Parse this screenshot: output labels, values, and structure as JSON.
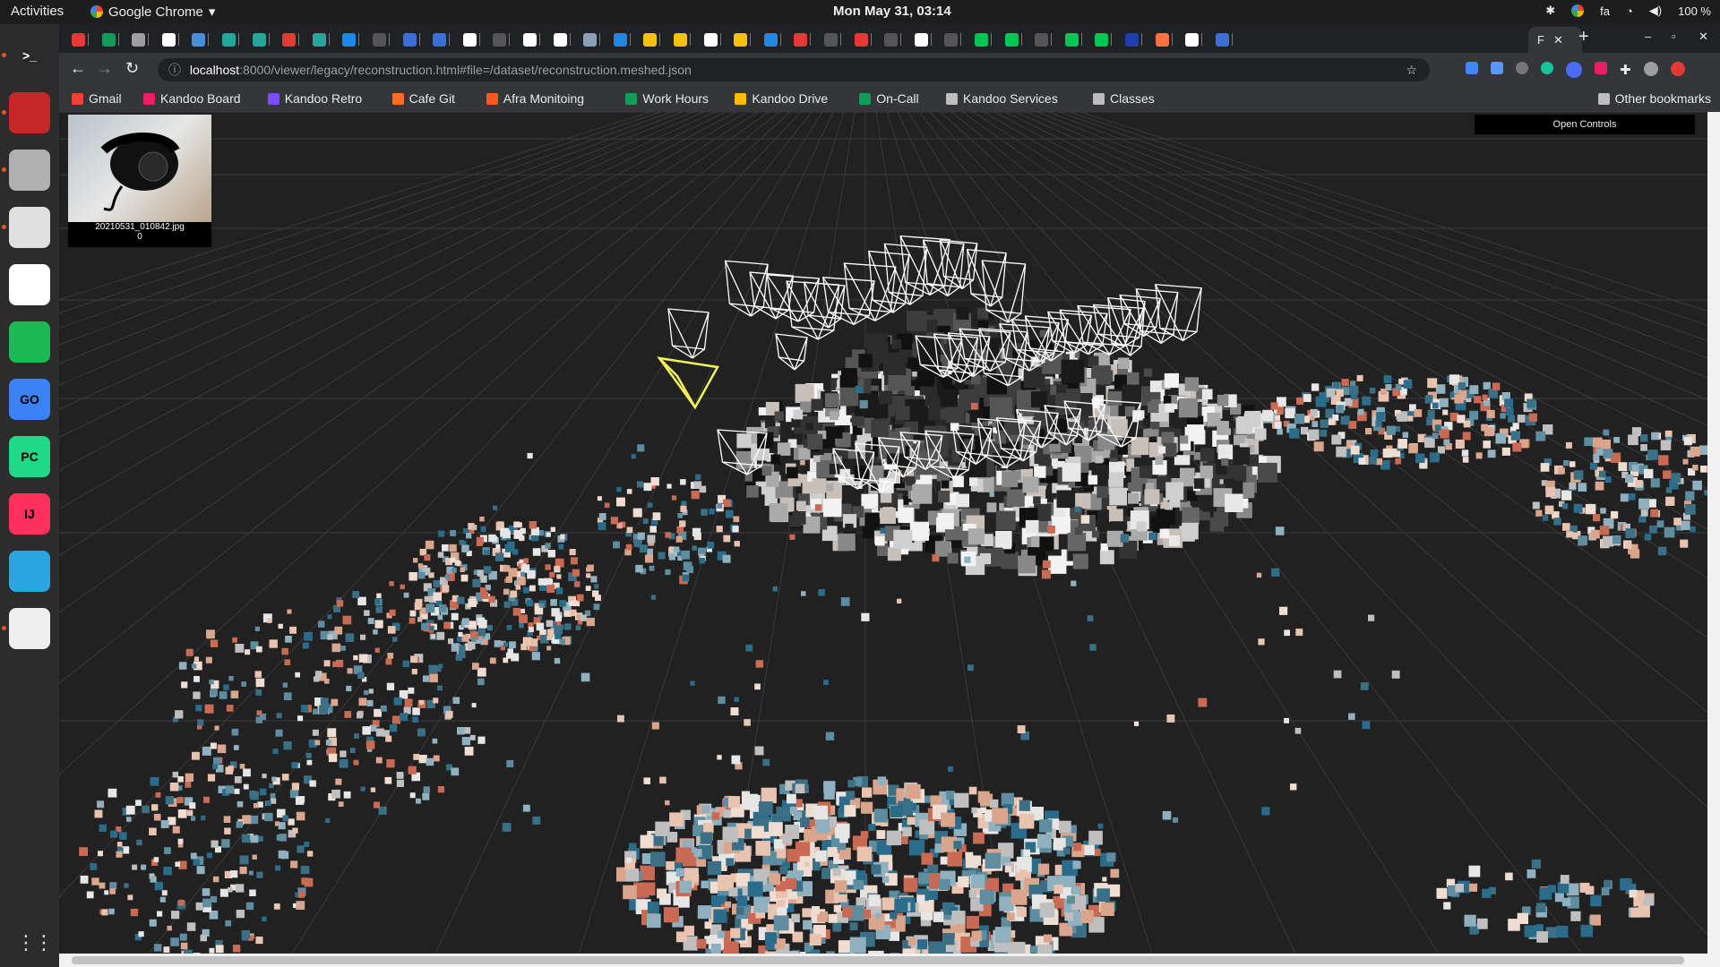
{
  "topbar": {
    "activities": "Activities",
    "app_name": "Google Chrome",
    "clock": "Mon May 31, 03:14",
    "input_lang": "fa",
    "battery": "100 %"
  },
  "dock": {
    "items": [
      {
        "name": "terminal",
        "label": ">_",
        "color": "#2b2b2b",
        "running": true
      },
      {
        "name": "slides-app",
        "label": "",
        "color": "#c62828",
        "running": true
      },
      {
        "name": "file-manager",
        "label": "",
        "color": "#b0b0b0",
        "running": true
      },
      {
        "name": "chrome",
        "label": "",
        "color": "#e0e0e0",
        "running": true
      },
      {
        "name": "slack",
        "label": "",
        "color": "#ffffff",
        "running": false
      },
      {
        "name": "spotify",
        "label": "",
        "color": "#1db954",
        "running": false
      },
      {
        "name": "goland",
        "label": "GO",
        "color": "#3b82f6",
        "running": false
      },
      {
        "name": "pycharm",
        "label": "PC",
        "color": "#21d789",
        "running": false
      },
      {
        "name": "intellij",
        "label": "IJ",
        "color": "#fe315d",
        "running": false
      },
      {
        "name": "telegram",
        "label": "",
        "color": "#2aa5e0",
        "running": false
      },
      {
        "name": "document-viewer",
        "label": "",
        "color": "#eeeeee",
        "running": true
      }
    ]
  },
  "tabs": {
    "favicon_colors": [
      "#e53935",
      "#0f9d58",
      "#9e9e9e",
      "#ffffff",
      "#4a90d9",
      "#26a69a",
      "#26a69a",
      "#e53935",
      "#26a69a",
      "#1e88e5",
      "#555555",
      "#3b6fd8",
      "#3b6fd8",
      "#ffffff",
      "#555555",
      "#ffffff",
      "#ffffff",
      "#8d9fb5",
      "#1e88e5",
      "#f4c20d",
      "#f4c20d",
      "#ffffff",
      "#f4c20d",
      "#1e88e5",
      "#e53935",
      "#555555",
      "#e53935",
      "#555555",
      "#ffffff",
      "#555555",
      "#00c853",
      "#00c853",
      "#555555",
      "#00c853",
      "#00c853",
      "#1e40af",
      "#ff7043",
      "#ffffff",
      "#3b6fd8"
    ],
    "active_tab_title": "F",
    "new_tab": "+"
  },
  "address": {
    "host": "localhost",
    "path": ":8000/viewer/legacy/reconstruction.html#file=/dataset/reconstruction.meshed.json"
  },
  "bookmarks": [
    {
      "label": "Gmail",
      "color": "#ea4335"
    },
    {
      "label": "Kandoo Board",
      "color": "#e91e63"
    },
    {
      "label": "Kandoo Retro",
      "color": "#7c4dff"
    },
    {
      "label": "Cafe Git",
      "color": "#fc6d26"
    },
    {
      "label": "Afra Monitoing",
      "color": "#ff5722"
    },
    {
      "label": "Work Hours",
      "color": "#0f9d58"
    },
    {
      "label": "Kandoo Drive",
      "color": "#fbbc05"
    },
    {
      "label": "On-Call",
      "color": "#0f9d58"
    },
    {
      "label": "Kandoo Services",
      "color": "#bdbdbd"
    },
    {
      "label": "Classes",
      "color": "#bdbdbd"
    }
  ],
  "other_bookmarks": "Other bookmarks",
  "viewer": {
    "image_filename": "20210531_010842.jpg",
    "image_index": "0",
    "open_controls": "Open Controls"
  }
}
